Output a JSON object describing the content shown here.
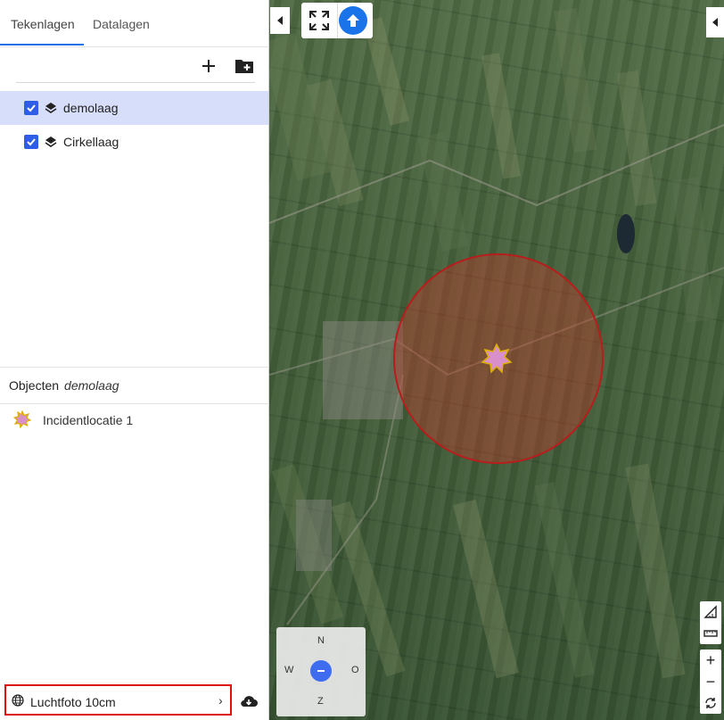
{
  "sidebar": {
    "tabs": [
      {
        "label": "Tekenlagen",
        "active": true
      },
      {
        "label": "Datalagen",
        "active": false
      }
    ],
    "toolbar": {
      "add_icon": "plus-icon",
      "add_folder_icon": "folder-plus-icon"
    },
    "layers": [
      {
        "label": "demolaag",
        "checked": true,
        "selected": true
      },
      {
        "label": "Cirkellaag",
        "checked": true,
        "selected": false
      }
    ],
    "objects": {
      "title": "Objecten",
      "layer_name": "demolaag",
      "items": [
        {
          "label": "Incidentlocatie 1",
          "icon": "star-marker-icon"
        }
      ]
    },
    "basemap": {
      "label": "Luchtfoto 10cm",
      "chevron": "›"
    }
  },
  "map": {
    "compass": {
      "n": "N",
      "w": "W",
      "o": "O",
      "z": "Z"
    },
    "zoom_in": "+",
    "zoom_out": "−",
    "circle_color": "#c0392b",
    "marker_fill": "#d98fc9",
    "marker_stroke": "#f1c40f",
    "accent": "#1a73e8"
  }
}
